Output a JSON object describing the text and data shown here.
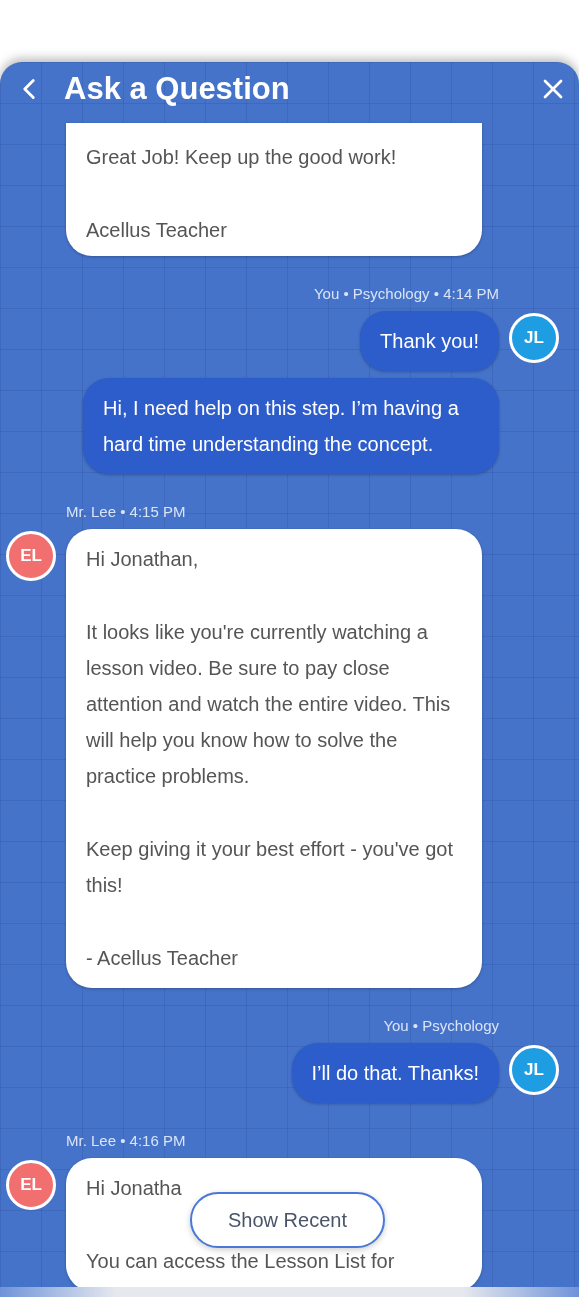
{
  "header": {
    "title": "Ask a Question"
  },
  "messages": [
    {
      "kind": "incoming",
      "continued": true,
      "paragraphs": [
        "Great Job! Keep up the good work!",
        "Acellus Teacher"
      ]
    },
    {
      "kind": "outgoing",
      "meta": "You • Psychology • 4:14 PM",
      "avatar": "JL",
      "paragraphs": [
        "Thank you!"
      ]
    },
    {
      "kind": "outgoing",
      "paragraphs": [
        "Hi, I need help on this step. I’m having a hard time understanding the concept."
      ]
    },
    {
      "kind": "incoming",
      "meta": "Mr. Lee • 4:15 PM",
      "avatar": "EL",
      "paragraphs": [
        "Hi Jonathan,",
        "It looks like you're currently watching a lesson video. Be sure to pay close attention and watch the entire video. This will help you know how to solve the practice problems.",
        "Keep giving it your best effort - you've got this!",
        "- Acellus Teacher"
      ]
    },
    {
      "kind": "outgoing",
      "meta": "You • Psychology",
      "avatar": "JL",
      "paragraphs": [
        "I’ll do that. Thanks!"
      ]
    },
    {
      "kind": "incoming",
      "meta": "Mr. Lee • 4:16 PM",
      "avatar": "EL",
      "paragraphs": [
        "Hi Jonatha",
        "You can access the Lesson List for"
      ]
    }
  ],
  "show_recent_button": "Show Recent"
}
